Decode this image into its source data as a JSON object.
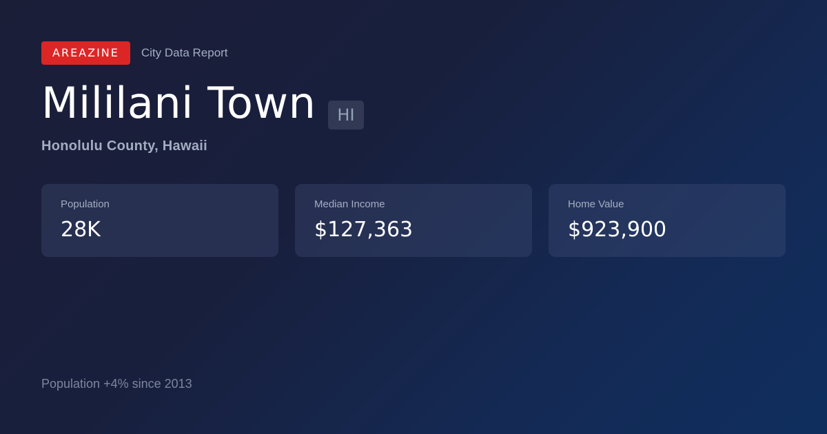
{
  "brand": {
    "name": "AREAZINE",
    "subtitle": "City Data Report"
  },
  "city": {
    "name": "Mililani Town",
    "state_code": "HI",
    "county_line": "Honolulu County, Hawaii"
  },
  "stats": [
    {
      "label": "Population",
      "value": "28K"
    },
    {
      "label": "Median Income",
      "value": "$127,363"
    },
    {
      "label": "Home Value",
      "value": "$923,900"
    }
  ],
  "footer": {
    "note": "Population +4% since 2013"
  },
  "colors": {
    "brand_accent": "#dc2626",
    "background_start": "#1b1e37",
    "background_end": "#0f2e5e"
  }
}
